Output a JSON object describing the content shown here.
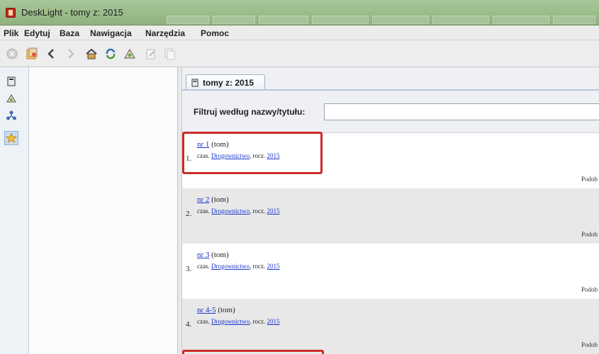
{
  "window": {
    "title": "DeskLight - tomy z: 2015"
  },
  "menu": {
    "items": [
      "Plik",
      "Edytuj",
      "Baza",
      "Nawigacja",
      "Narzędzia",
      "Pomoc"
    ]
  },
  "toolbar": {
    "buttons": [
      "stop-icon",
      "open-icon",
      "back-icon",
      "forward-icon",
      "home-icon",
      "sync-icon",
      "search-hat-icon",
      "edit-icon",
      "copy-icon"
    ]
  },
  "tab": {
    "label": "tomy z: 2015"
  },
  "filter": {
    "label": "Filtruj według nazwy/tytułu:",
    "value": "",
    "placeholder": ""
  },
  "results": [
    {
      "num": "1.",
      "link": "nr 1",
      "suffix": " (tom)",
      "meta_prefix": "czas. ",
      "journal": "Drogownictwo",
      "meta_mid": ", rocz. ",
      "year": "2015",
      "right": "Podob"
    },
    {
      "num": "2.",
      "link": "nr 2",
      "suffix": " (tom)",
      "meta_prefix": "czas. ",
      "journal": "Drogownictwo",
      "meta_mid": ", rocz. ",
      "year": "2015",
      "right": "Podob"
    },
    {
      "num": "3.",
      "link": "nr 3",
      "suffix": " (tom)",
      "meta_prefix": "czas. ",
      "journal": "Drogownictwo",
      "meta_mid": ", rocz. ",
      "year": "2015",
      "right": "Podob"
    },
    {
      "num": "4.",
      "link": "nr 4-5",
      "suffix": " (tom)",
      "meta_prefix": "czas. ",
      "journal": "Drogownictwo",
      "meta_mid": ", rocz. ",
      "year": "2015",
      "right": "Podob"
    }
  ],
  "colors": {
    "highlight": "#cf2a2a",
    "link": "#1a33cc",
    "titlebar": "#9dbb8c"
  }
}
